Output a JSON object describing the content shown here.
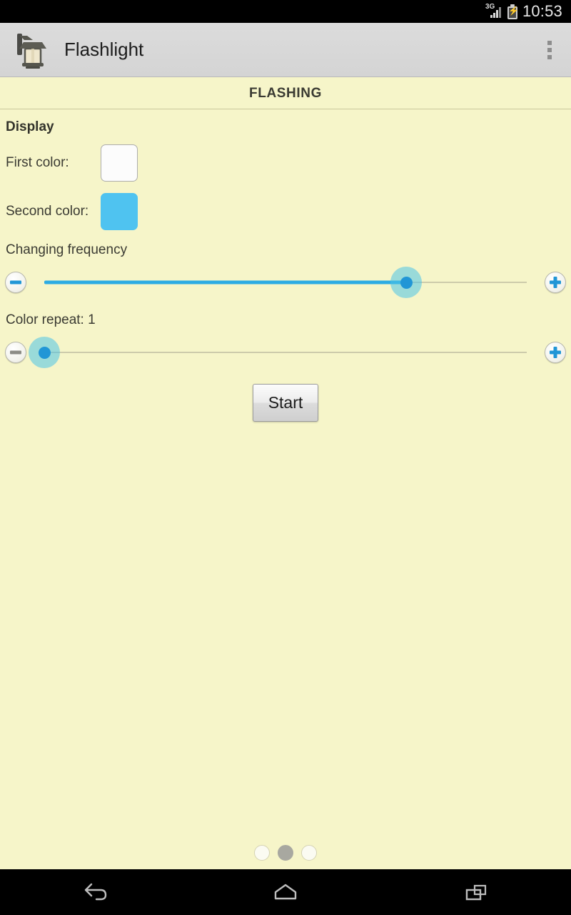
{
  "status_bar": {
    "network_label": "3G",
    "signal_icon": "signal-bars-icon",
    "battery_icon": "battery-charging-icon",
    "time": "10:53"
  },
  "action_bar": {
    "app_icon": "lantern-icon",
    "title": "Flashlight",
    "overflow_icon": "overflow-menu-icon"
  },
  "tab": {
    "title": "FLASHING"
  },
  "main": {
    "section_title": "Display",
    "first_color": {
      "label": "First color:",
      "swatch_icon": "color-swatch",
      "value": "#FCFCFC"
    },
    "second_color": {
      "label": "Second color:",
      "swatch_icon": "color-swatch",
      "value": "#4FC3F0"
    },
    "frequency_slider": {
      "label": "Changing frequency",
      "minus_icon": "minus-icon",
      "plus_icon": "plus-icon",
      "percent": 75,
      "minus_disabled": false
    },
    "repeat_slider": {
      "label": "Color repeat: 1",
      "minus_icon": "minus-icon",
      "plus_icon": "plus-icon",
      "percent": 0,
      "minus_disabled": true
    },
    "start_button": "Start"
  },
  "page_indicator": {
    "total": 3,
    "active_index": 1
  },
  "nav_bar": {
    "back": "back-icon",
    "home": "home-icon",
    "recents": "recents-icon"
  },
  "colors": {
    "background": "#F6F5C9",
    "accent": "#2196D6",
    "track": "#2CABE3",
    "action_bar": "#DCDCDC"
  }
}
